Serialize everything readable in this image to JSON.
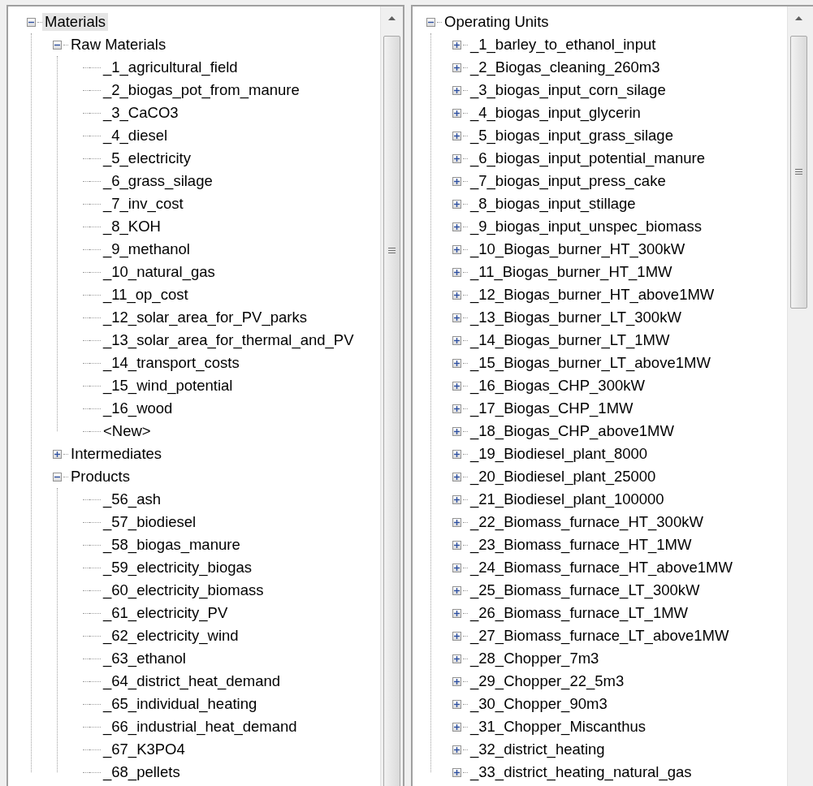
{
  "left_tree": [
    {
      "label": "Materials",
      "expanded": true,
      "selected": true,
      "children": [
        {
          "label": "Raw Materials",
          "expanded": true,
          "selected": false,
          "children": [
            {
              "label": "_1_agricultural_field",
              "selected": false
            },
            {
              "label": "_2_biogas_pot_from_manure",
              "selected": false
            },
            {
              "label": "_3_CaCO3",
              "selected": false
            },
            {
              "label": "_4_diesel",
              "selected": false
            },
            {
              "label": "_5_electricity",
              "selected": false
            },
            {
              "label": "_6_grass_silage",
              "selected": false
            },
            {
              "label": "_7_inv_cost",
              "selected": false
            },
            {
              "label": "_8_KOH",
              "selected": false
            },
            {
              "label": "_9_methanol",
              "selected": false
            },
            {
              "label": "_10_natural_gas",
              "selected": false
            },
            {
              "label": "_11_op_cost",
              "selected": false
            },
            {
              "label": "_12_solar_area_for_PV_parks",
              "selected": false
            },
            {
              "label": "_13_solar_area_for_thermal_and_PV",
              "selected": false
            },
            {
              "label": "_14_transport_costs",
              "selected": false
            },
            {
              "label": "_15_wind_potential",
              "selected": false
            },
            {
              "label": "_16_wood",
              "selected": false
            },
            {
              "label": "<New>",
              "selected": false
            }
          ]
        },
        {
          "label": "Intermediates",
          "expanded": false,
          "selected": false
        },
        {
          "label": "Products",
          "expanded": true,
          "selected": false,
          "children": [
            {
              "label": "_56_ash",
              "selected": false
            },
            {
              "label": "_57_biodiesel",
              "selected": false
            },
            {
              "label": "_58_biogas_manure",
              "selected": false
            },
            {
              "label": "_59_electricity_biogas",
              "selected": false
            },
            {
              "label": "_60_electricity_biomass",
              "selected": false
            },
            {
              "label": "_61_electricity_PV",
              "selected": false
            },
            {
              "label": "_62_electricity_wind",
              "selected": false
            },
            {
              "label": "_63_ethanol",
              "selected": false
            },
            {
              "label": "_64_district_heat_demand",
              "selected": false
            },
            {
              "label": "_65_individual_heating",
              "selected": false
            },
            {
              "label": "_66_industrial_heat_demand",
              "selected": false
            },
            {
              "label": "_67_K3PO4",
              "selected": false
            },
            {
              "label": "_68_pellets",
              "selected": false
            }
          ]
        }
      ]
    }
  ],
  "right_tree": [
    {
      "label": "Operating Units",
      "expanded": true,
      "selected": false,
      "children": [
        {
          "label": "_1_barley_to_ethanol_input",
          "expanded": false,
          "selected": false
        },
        {
          "label": "_2_Biogas_cleaning_260m3",
          "expanded": false,
          "selected": false
        },
        {
          "label": "_3_biogas_input_corn_silage",
          "expanded": false,
          "selected": false
        },
        {
          "label": "_4_biogas_input_glycerin",
          "expanded": false,
          "selected": false
        },
        {
          "label": "_5_biogas_input_grass_silage",
          "expanded": false,
          "selected": false
        },
        {
          "label": "_6_biogas_input_potential_manure",
          "expanded": false,
          "selected": false
        },
        {
          "label": "_7_biogas_input_press_cake",
          "expanded": false,
          "selected": false
        },
        {
          "label": "_8_biogas_input_stillage",
          "expanded": false,
          "selected": false
        },
        {
          "label": "_9_biogas_input_unspec_biomass",
          "expanded": false,
          "selected": false
        },
        {
          "label": "_10_Biogas_burner_HT_300kW",
          "expanded": false,
          "selected": false
        },
        {
          "label": "_11_Biogas_burner_HT_1MW",
          "expanded": false,
          "selected": false
        },
        {
          "label": "_12_Biogas_burner_HT_above1MW",
          "expanded": false,
          "selected": false
        },
        {
          "label": "_13_Biogas_burner_LT_300kW",
          "expanded": false,
          "selected": false
        },
        {
          "label": "_14_Biogas_burner_LT_1MW",
          "expanded": false,
          "selected": false
        },
        {
          "label": "_15_Biogas_burner_LT_above1MW",
          "expanded": false,
          "selected": false
        },
        {
          "label": "_16_Biogas_CHP_300kW",
          "expanded": false,
          "selected": false
        },
        {
          "label": "_17_Biogas_CHP_1MW",
          "expanded": false,
          "selected": false
        },
        {
          "label": "_18_Biogas_CHP_above1MW",
          "expanded": false,
          "selected": false
        },
        {
          "label": "_19_Biodiesel_plant_8000",
          "expanded": false,
          "selected": false
        },
        {
          "label": "_20_Biodiesel_plant_25000",
          "expanded": false,
          "selected": false
        },
        {
          "label": "_21_Biodiesel_plant_100000",
          "expanded": false,
          "selected": false
        },
        {
          "label": "_22_Biomass_furnace_HT_300kW",
          "expanded": false,
          "selected": false
        },
        {
          "label": "_23_Biomass_furnace_HT_1MW",
          "expanded": false,
          "selected": false
        },
        {
          "label": "_24_Biomass_furnace_HT_above1MW",
          "expanded": false,
          "selected": false
        },
        {
          "label": "_25_Biomass_furnace_LT_300kW",
          "expanded": false,
          "selected": false
        },
        {
          "label": "_26_Biomass_furnace_LT_1MW",
          "expanded": false,
          "selected": false
        },
        {
          "label": "_27_Biomass_furnace_LT_above1MW",
          "expanded": false,
          "selected": false
        },
        {
          "label": "_28_Chopper_7m3",
          "expanded": false,
          "selected": false
        },
        {
          "label": "_29_Chopper_22_5m3",
          "expanded": false,
          "selected": false
        },
        {
          "label": "_30_Chopper_90m3",
          "expanded": false,
          "selected": false
        },
        {
          "label": "_31_Chopper_Miscanthus",
          "expanded": false,
          "selected": false
        },
        {
          "label": "_32_district_heating",
          "expanded": false,
          "selected": false
        },
        {
          "label": "_33_district_heating_natural_gas",
          "expanded": false,
          "selected": false
        }
      ]
    }
  ]
}
